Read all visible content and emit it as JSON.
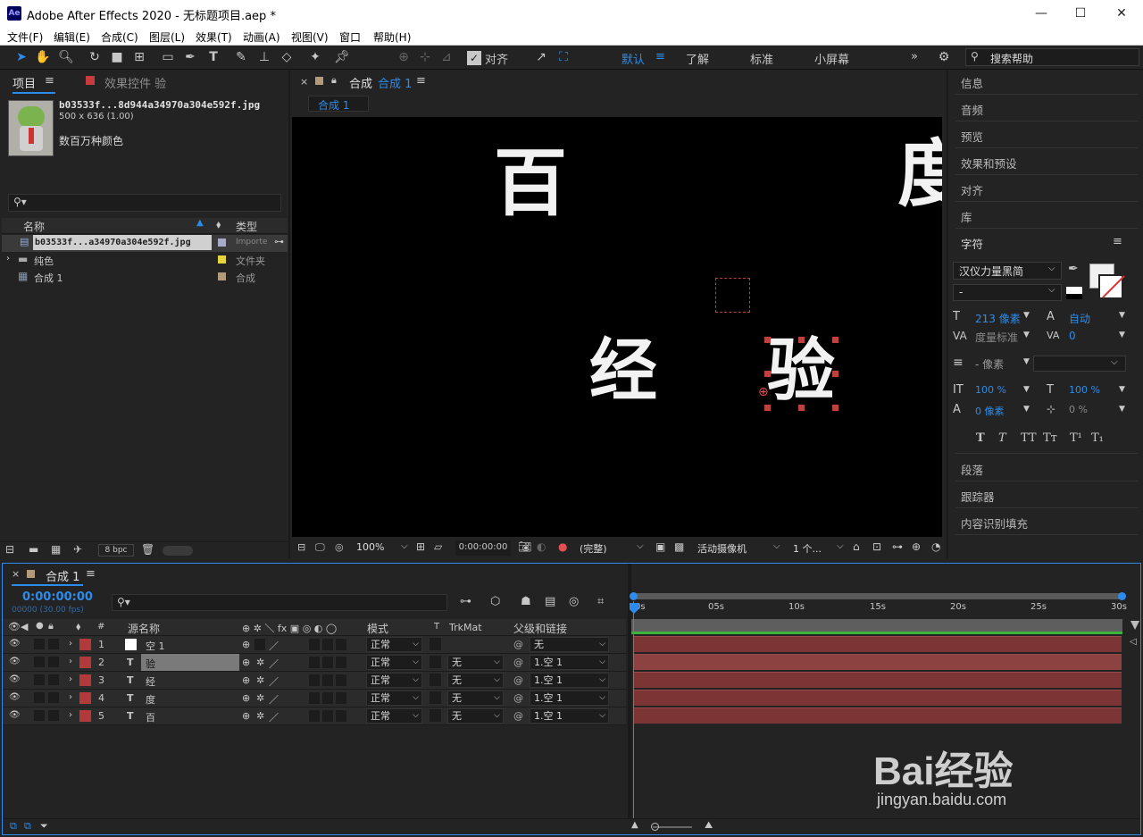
{
  "window": {
    "title": "Adobe After Effects 2020 - 无标题项目.aep *",
    "app_icon": "Ae"
  },
  "menu": [
    "文件(F)",
    "编辑(E)",
    "合成(C)",
    "图层(L)",
    "效果(T)",
    "动画(A)",
    "视图(V)",
    "窗口",
    "帮助(H)"
  ],
  "toolbar": {
    "align_label": "对齐",
    "workspaces": [
      "默认",
      "了解",
      "标准",
      "小屏幕"
    ],
    "search_placeholder": "搜索帮助"
  },
  "project": {
    "tab_label": "项目",
    "effects_tab_label": "效果控件 验",
    "file_name": "b03533f...8d944a34970a304e592f.jpg",
    "file_dims": "500 x 636 (1.00)",
    "file_desc": "数百万种颜色",
    "col_name": "名称",
    "col_type": "类型",
    "bpc": "8 bpc",
    "items": [
      {
        "name": "b03533f...a34970a304e592f.jpg",
        "type": "Importe",
        "color": "#a9a9c8"
      },
      {
        "name": "纯色",
        "type": "文件夹",
        "color": "#e6d53a"
      },
      {
        "name": "合成 1",
        "type": "合成",
        "color": "#b39a7a"
      }
    ]
  },
  "composition": {
    "tab_label": "合成",
    "tab_name": "合成 1",
    "sub_tab": "合成 1",
    "chars": [
      "百",
      "度",
      "经",
      "验"
    ],
    "zoom": "100%",
    "timecode": "0:00:00:00",
    "quality": "(完整)",
    "camera": "活动摄像机",
    "views": "1 个..."
  },
  "right_panel": {
    "items_top": [
      "信息",
      "音频",
      "预览",
      "效果和预设",
      "对齐",
      "库"
    ],
    "character": {
      "title": "字符",
      "font": "汉仪力量黑简",
      "style": "-",
      "size": "213 像素",
      "leading": "自动",
      "kerning": "度量标准",
      "tracking": "0",
      "stroke": "- 像素",
      "vscale": "100 %",
      "hscale": "100 %",
      "baseline": "0 像素",
      "tsume": "0 %",
      "styles": [
        "T",
        "T",
        "TT",
        "Tт",
        "T¹",
        "T₁"
      ]
    },
    "items_bottom": [
      "段落",
      "跟踪器",
      "内容识别填充"
    ]
  },
  "timeline": {
    "tab_label": "合成 1",
    "timecode": "0:00:00:00",
    "frame_info": "00000 (30.00 fps)",
    "headers": {
      "source": "源名称",
      "mode": "模式",
      "t": "T",
      "trkmat": "TrkMat",
      "parent": "父级和链接"
    },
    "ruler": [
      "0s",
      "05s",
      "10s",
      "15s",
      "20s",
      "25s",
      "30s"
    ],
    "layers": [
      {
        "num": "1",
        "type": "",
        "name": "空 1",
        "mode": "正常",
        "trkmat": "",
        "parent": "无"
      },
      {
        "num": "2",
        "type": "T",
        "name": "验",
        "mode": "正常",
        "trkmat": "无",
        "parent": "1.空 1"
      },
      {
        "num": "3",
        "type": "T",
        "name": "经",
        "mode": "正常",
        "trkmat": "无",
        "parent": "1.空 1"
      },
      {
        "num": "4",
        "type": "T",
        "name": "度",
        "mode": "正常",
        "trkmat": "无",
        "parent": "1.空 1"
      },
      {
        "num": "5",
        "type": "T",
        "name": "百",
        "mode": "正常",
        "trkmat": "无",
        "parent": "1.空 1"
      }
    ]
  },
  "watermark": {
    "brand": "Bai经验",
    "url": "jingyan.baidu.com"
  }
}
